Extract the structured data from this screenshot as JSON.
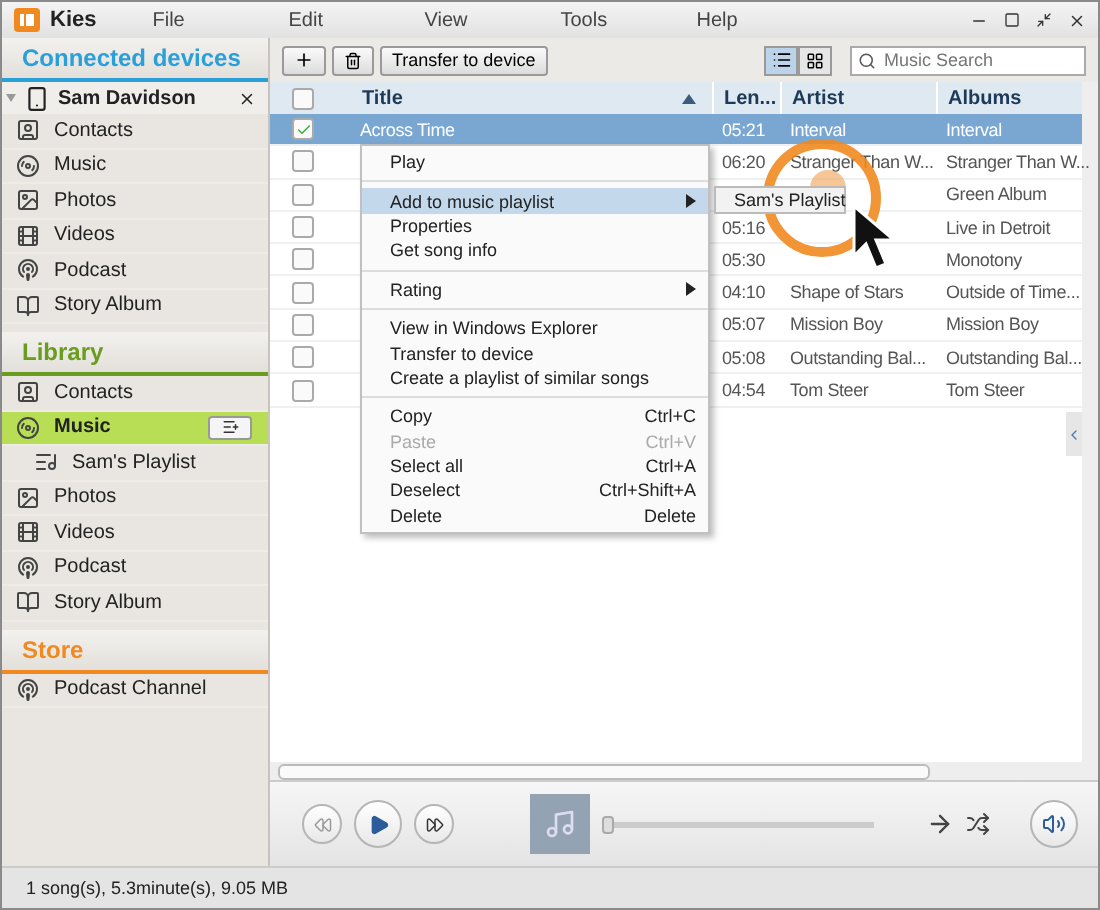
{
  "window": {
    "app_name": "Kies",
    "menu": [
      "File",
      "Edit",
      "View",
      "Tools",
      "Help"
    ]
  },
  "sidebar": {
    "sections": [
      {
        "title": "Connected devices",
        "color": "#2a9fd8",
        "device": {
          "name": "Sam Davidson",
          "expanded": true
        },
        "items": [
          {
            "label": "Contacts",
            "kind": "contacts",
            "selected": false
          },
          {
            "label": "Music",
            "kind": "music",
            "selected": false
          },
          {
            "label": "Photos",
            "kind": "photos",
            "selected": false
          },
          {
            "label": "Videos",
            "kind": "videos",
            "selected": false
          },
          {
            "label": "Podcast",
            "kind": "podcast",
            "selected": false
          },
          {
            "label": "Story Album",
            "kind": "story",
            "selected": false
          }
        ]
      },
      {
        "title": "Library",
        "color": "#6a9c20",
        "items": [
          {
            "label": "Contacts",
            "kind": "contacts",
            "selected": false
          },
          {
            "label": "Music",
            "kind": "music",
            "selected": true,
            "children": [
              {
                "label": "Sam's Playlist",
                "kind": "playlist",
                "selected": false
              }
            ]
          },
          {
            "label": "Photos",
            "kind": "photos",
            "selected": false
          },
          {
            "label": "Videos",
            "kind": "videos",
            "selected": false
          },
          {
            "label": "Podcast",
            "kind": "podcast",
            "selected": false
          },
          {
            "label": "Story Album",
            "kind": "story",
            "selected": false
          }
        ]
      },
      {
        "title": "Store",
        "color": "#f08a20",
        "items": [
          {
            "label": "Podcast Channel",
            "kind": "podcast",
            "selected": false
          }
        ]
      }
    ]
  },
  "toolbar": {
    "transfer_button": "Transfer to device",
    "views": [
      {
        "kind": "list",
        "selected": true
      },
      {
        "kind": "grid",
        "selected": false
      }
    ],
    "search": {
      "placeholder": "Music Search"
    }
  },
  "table": {
    "select_all_checked": false,
    "columns": [
      {
        "label": "Title",
        "sorted": true
      },
      {
        "label": "Len..."
      },
      {
        "label": "Artist"
      },
      {
        "label": "Albums"
      }
    ],
    "rows": [
      {
        "title": "Across Time",
        "length": "05:21",
        "artist": "Interval",
        "album": "Interval",
        "selected": true,
        "checked": true
      },
      {
        "length": "06:20",
        "artist": "Stranger Than W...",
        "album": "Stranger Than W...",
        "selected": false,
        "checked": false
      },
      {
        "album": "Green Album",
        "selected": false,
        "checked": false
      },
      {
        "length": "05:16",
        "album": "Live in Detroit",
        "selected": false,
        "checked": false
      },
      {
        "length": "05:30",
        "album": "Monotony",
        "selected": false,
        "checked": false
      },
      {
        "length": "04:10",
        "artist": "Shape of Stars",
        "album": "Outside of Time...",
        "selected": false,
        "checked": false
      },
      {
        "length": "05:07",
        "artist": "Mission Boy",
        "album": "Mission Boy",
        "selected": false,
        "checked": false
      },
      {
        "length": "05:08",
        "artist": "Outstanding Bal...",
        "album": "Outstanding Bal...",
        "selected": false,
        "checked": false
      },
      {
        "length": "04:54",
        "artist": "Tom Steer",
        "album": "Tom Steer",
        "selected": false,
        "checked": false
      }
    ]
  },
  "context_menu": {
    "items": [
      {
        "kind": "item",
        "label": "Play",
        "selected": false,
        "disabled": false
      },
      {
        "kind": "separator"
      },
      {
        "kind": "item",
        "label": "Add to music playlist",
        "selected": true,
        "disabled": false,
        "submenu": [
          {
            "label": "Sam's Playlist"
          }
        ]
      },
      {
        "kind": "item",
        "label": "Properties",
        "selected": false,
        "disabled": false
      },
      {
        "kind": "item",
        "label": "Get song info",
        "selected": false,
        "disabled": false
      },
      {
        "kind": "separator"
      },
      {
        "kind": "item",
        "label": "Rating",
        "selected": false,
        "disabled": false,
        "has_submenu": true
      },
      {
        "kind": "separator"
      },
      {
        "kind": "item",
        "label": "View in Windows Explorer",
        "selected": false,
        "disabled": false
      },
      {
        "kind": "item",
        "label": "Transfer to device",
        "selected": false,
        "disabled": false
      },
      {
        "kind": "item",
        "label": "Create a playlist of similar songs",
        "selected": false,
        "disabled": false
      },
      {
        "kind": "separator"
      },
      {
        "kind": "item",
        "label": "Copy",
        "shortcut": "Ctrl+C",
        "selected": false,
        "disabled": false
      },
      {
        "kind": "item",
        "label": "Paste",
        "shortcut": "Ctrl+V",
        "selected": false,
        "disabled": true
      },
      {
        "kind": "item",
        "label": "Select all",
        "shortcut": "Ctrl+A",
        "selected": false,
        "disabled": false
      },
      {
        "kind": "item",
        "label": "Deselect",
        "shortcut": "Ctrl+Shift+A",
        "selected": false,
        "disabled": false
      },
      {
        "kind": "item",
        "label": "Delete",
        "shortcut": "Delete",
        "selected": false,
        "disabled": false
      }
    ]
  },
  "player": {
    "level": 0
  },
  "status_bar": "1 song(s), 5.3minute(s), 9.05 MB"
}
